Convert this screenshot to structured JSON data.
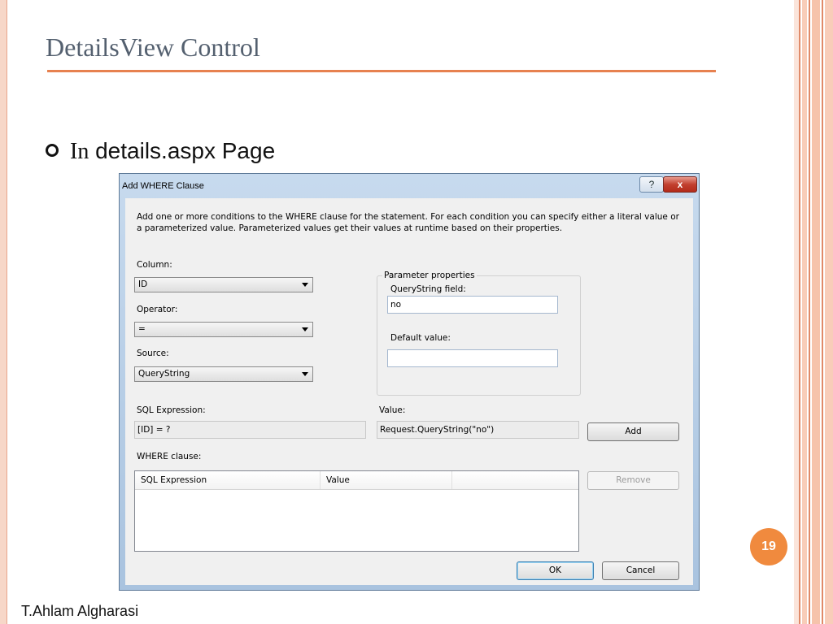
{
  "slide": {
    "title": "DetailsView Control",
    "bullet_serif": "In",
    "bullet_rest": " details.aspx Page",
    "page_number": "19",
    "author": "T.Ahlam Algharasi"
  },
  "dialog": {
    "title": "Add WHERE Clause",
    "help_label": "?",
    "close_label": "x",
    "description": "Add one or more conditions to the WHERE clause for the statement. For each condition you can specify either a literal value or a parameterized value. Parameterized values get their values at runtime based on their properties.",
    "column_label": "Column:",
    "column_value": "ID",
    "operator_label": "Operator:",
    "operator_value": "=",
    "source_label": "Source:",
    "source_value": "QueryString",
    "parameter_group_label": "Parameter properties",
    "querystring_field_label": "QueryString field:",
    "querystring_field_value": "no",
    "default_value_label": "Default value:",
    "default_value_value": "",
    "sql_expression_label": "SQL Expression:",
    "sql_expression_value": "[ID] = ?",
    "value_label": "Value:",
    "value_value": "Request.QueryString(\"no\")",
    "add_button": "Add",
    "where_clause_label": "WHERE clause:",
    "list_columns": [
      "SQL Expression",
      "Value",
      ""
    ],
    "remove_button": "Remove",
    "ok_button": "OK",
    "cancel_button": "Cancel"
  },
  "colors": {
    "accent_orange": "#e7814f",
    "title_color": "#54606f",
    "badge_orange": "#f08a3e"
  }
}
